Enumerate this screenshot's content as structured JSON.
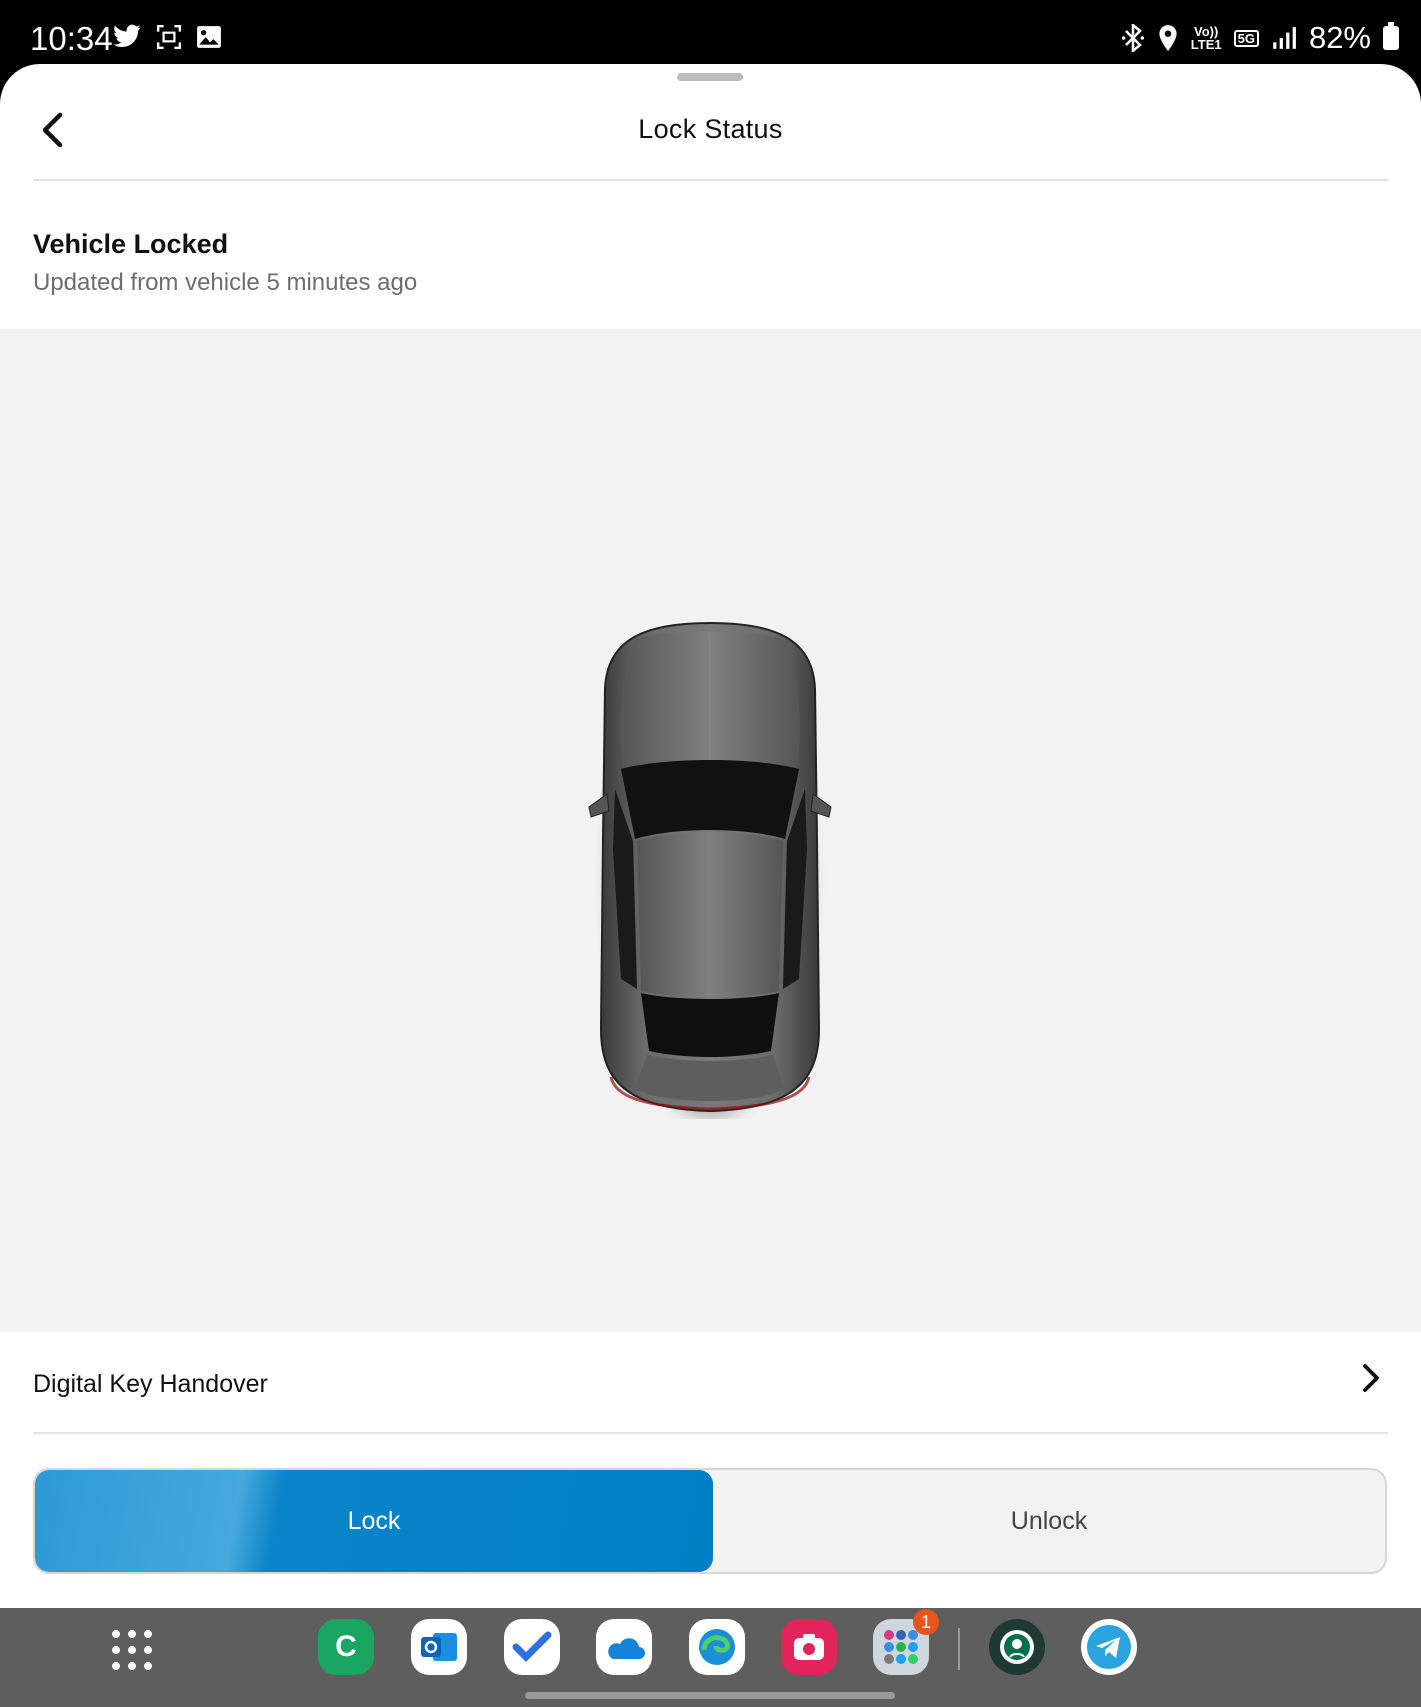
{
  "status_bar": {
    "time": "10:34",
    "volte_top": "Vo))",
    "volte_bottom": "LTE1",
    "network": "5G",
    "battery": "82%"
  },
  "header": {
    "title": "Lock Status"
  },
  "lock_status": {
    "heading": "Vehicle Locked",
    "updated": "Updated from vehicle 5 minutes ago"
  },
  "digital_key": {
    "label": "Digital Key Handover"
  },
  "segment": {
    "lock_label": "Lock",
    "unlock_label": "Unlock",
    "selected": "Lock"
  },
  "taskbar": {
    "folder_badge": "1",
    "apps": [
      "phone-c-app",
      "outlook-app",
      "todo-app",
      "onedrive-app",
      "edge-app",
      "screen-recorder-app",
      "app-folder",
      "starbucks-app",
      "telegram-app"
    ]
  },
  "colors": {
    "accent": "#0080c4",
    "background": "#f2f2f2",
    "taskbar": "#5e5e5e"
  }
}
